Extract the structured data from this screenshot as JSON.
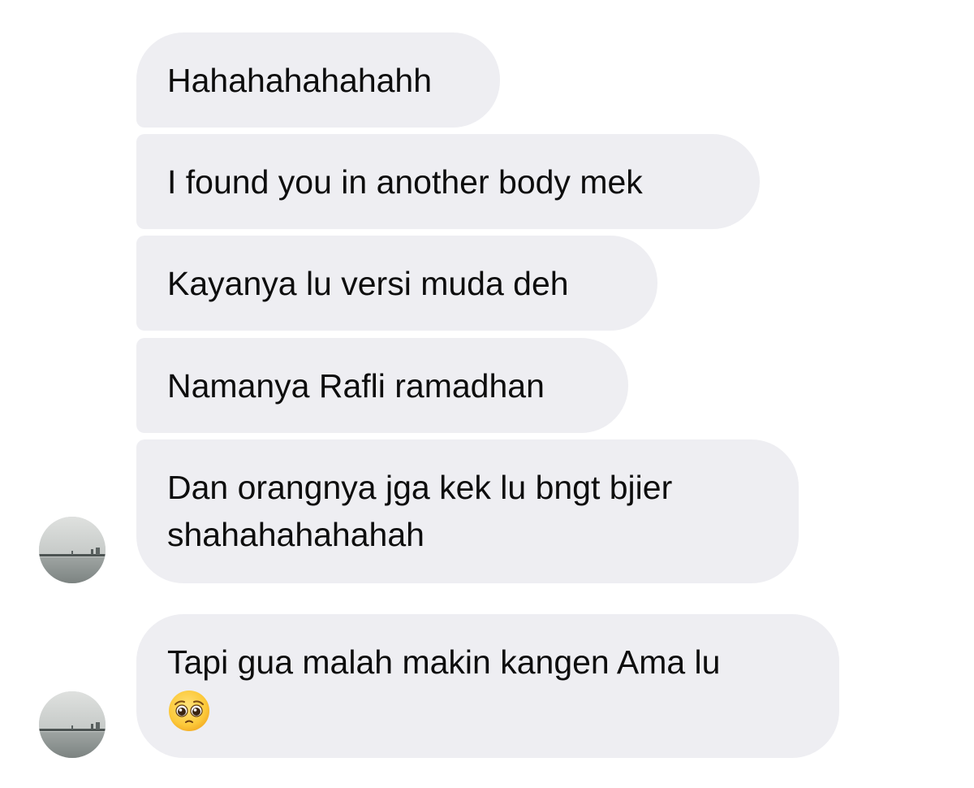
{
  "conversation": {
    "messages": [
      {
        "text": "Hahahahahahahh"
      },
      {
        "text": "I found you in another body mek"
      },
      {
        "text": "Kayanya lu versi muda deh"
      },
      {
        "text": "Namanya Rafli ramadhan"
      },
      {
        "text": "Dan orangnya jga kek lu bngt bjier\nshahahahahahah"
      },
      {
        "text": "Tapi gua malah makin kangen Ama lu",
        "emoji": "pleading-face-emoji"
      }
    ],
    "avatars": [
      {
        "icon": "contact-avatar-photo"
      },
      {
        "icon": "contact-avatar-photo"
      }
    ]
  },
  "colors": {
    "bubble_background": "#eeeef2",
    "text": "#0d0d0d",
    "page_background": "#ffffff"
  }
}
